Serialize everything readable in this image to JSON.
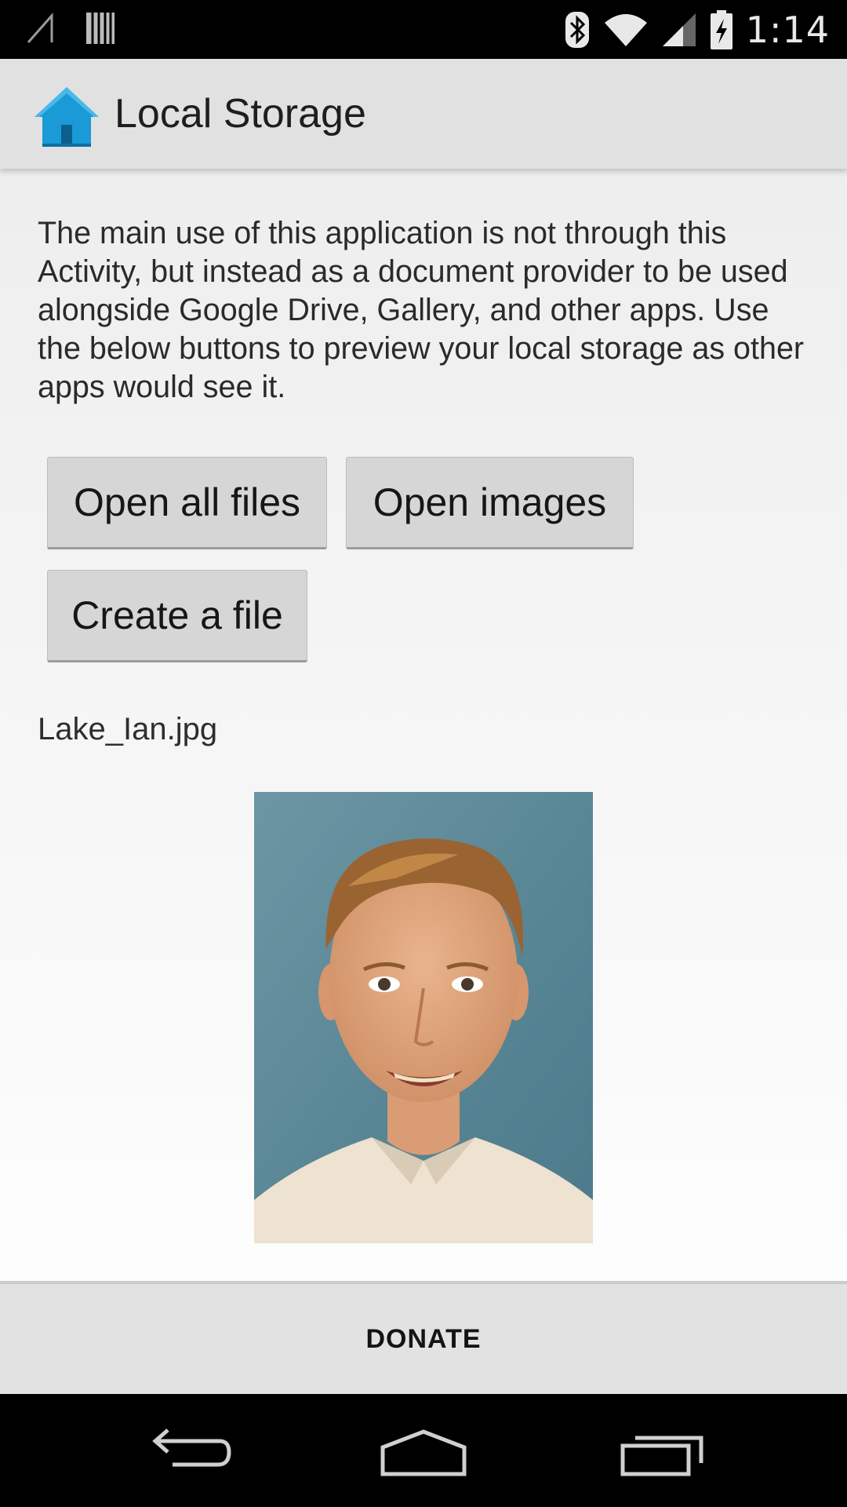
{
  "status_bar": {
    "time": "1:14",
    "icons": [
      "no-signal-icon",
      "storage-icon",
      "bluetooth-icon",
      "wifi-icon",
      "cell-signal-icon",
      "battery-charging-icon"
    ]
  },
  "action_bar": {
    "title": "Local Storage",
    "icon": "home-icon"
  },
  "main": {
    "description": "The main use of this application is not through this Activity, but instead as a document provider to be used alongside Google Drive, Gallery, and other apps. Use the below buttons to preview your local storage as other apps would see it.",
    "buttons": {
      "open_all_files": "Open all files",
      "open_images": "Open images",
      "create_file": "Create a file"
    },
    "file_name": "Lake_Ian.jpg",
    "preview_image": "portrait-photo"
  },
  "donate": {
    "label": "DONATE"
  },
  "nav_bar": {
    "icons": [
      "back-icon",
      "home-nav-icon",
      "recents-icon"
    ]
  },
  "colors": {
    "accent_home": "#1a9ad6",
    "action_bar_bg": "#e1e1e1",
    "button_bg": "#d6d6d6"
  }
}
